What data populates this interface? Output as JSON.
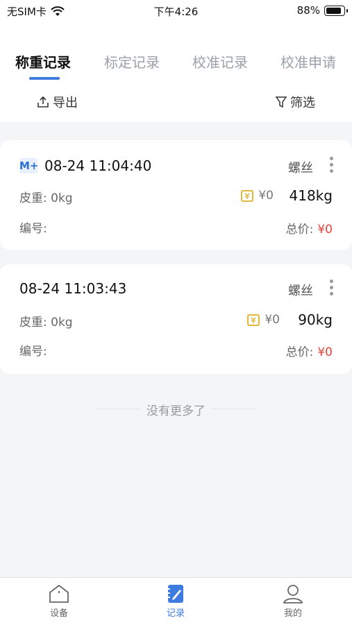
{
  "status_bar": {
    "carrier": "无SIM卡",
    "time": "下午4:26",
    "battery": "88%"
  },
  "tabs": [
    {
      "label": "称重记录"
    },
    {
      "label": "标定记录"
    },
    {
      "label": "校准记录"
    },
    {
      "label": "校准申请"
    }
  ],
  "toolbar": {
    "export_label": "导出",
    "filter_label": "筛选"
  },
  "records": [
    {
      "badge": "M+",
      "datetime": "08-24 11:04:40",
      "product": "螺丝",
      "tare": "皮重: 0kg",
      "price": "¥0",
      "weight": "418kg",
      "code_label": "编号:",
      "total_label": "总价:",
      "total_value": "¥0"
    },
    {
      "datetime": "08-24 11:03:43",
      "product": "螺丝",
      "tare": "皮重: 0kg",
      "price": "¥0",
      "weight": "90kg",
      "code_label": "编号:",
      "total_label": "总价:",
      "total_value": "¥0"
    }
  ],
  "footer_text": "没有更多了",
  "bottom_nav": [
    {
      "label": "设备",
      "icon": "home-icon"
    },
    {
      "label": "记录",
      "icon": "record-icon"
    },
    {
      "label": "我的",
      "icon": "user-icon"
    }
  ],
  "colors": {
    "accent": "#3d7be0",
    "price_red": "#e0443a",
    "coin_yellow": "#e2b93b"
  }
}
